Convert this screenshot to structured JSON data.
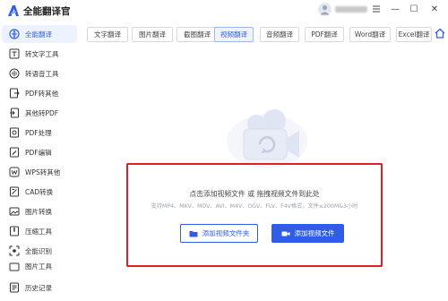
{
  "app": {
    "title": "全能翻译官"
  },
  "window": {
    "minimize": "—",
    "restore": "☐",
    "close": "✕"
  },
  "colors": {
    "accent": "#2f5de8",
    "highlight_border": "#e21d25",
    "active_bg": "#edf2ff"
  },
  "sidebar": {
    "items": [
      {
        "label": "全能翻译",
        "icon": "translate-icon",
        "active": true
      },
      {
        "label": "转文字工具",
        "icon": "text-convert-icon",
        "active": false
      },
      {
        "label": "转语音工具",
        "icon": "voice-icon",
        "active": false
      },
      {
        "label": "PDF转其他",
        "icon": "pdf-export-icon",
        "active": false
      },
      {
        "label": "其他转PDF",
        "icon": "pdf-import-icon",
        "active": false
      },
      {
        "label": "PDF处理",
        "icon": "pdf-process-icon",
        "active": false
      },
      {
        "label": "PDF编辑",
        "icon": "pdf-edit-icon",
        "active": false
      },
      {
        "label": "WPS转其他",
        "icon": "wps-icon",
        "active": false
      },
      {
        "label": "CAD转换",
        "icon": "cad-icon",
        "active": false
      },
      {
        "label": "图片转换",
        "icon": "image-convert-icon",
        "active": false
      },
      {
        "label": "压缩工具",
        "icon": "compress-icon",
        "active": false
      },
      {
        "label": "全能识别",
        "icon": "recognize-icon",
        "active": false
      },
      {
        "label": "图片工具",
        "icon": "image-tool-icon",
        "active": false
      },
      {
        "label": "历史记录",
        "icon": "history-icon",
        "active": false
      }
    ]
  },
  "tabs": [
    {
      "label": "文字翻译",
      "active": false
    },
    {
      "label": "图片翻译",
      "active": false
    },
    {
      "label": "截图翻译",
      "active": false
    },
    {
      "label": "视频翻译",
      "active": true
    },
    {
      "label": "音频翻译",
      "active": false
    },
    {
      "label": "PDF翻译",
      "active": false
    },
    {
      "label": "Word翻译",
      "active": false
    },
    {
      "label": "Excel翻译",
      "active": false
    }
  ],
  "dropzone": {
    "main_text": "点击添加视频文件 或 拖拽视频文件到此处",
    "sub_text": "支持MP4、MKV、MOV、AVI、M4V、OGV、FLV、F4V格式，文件≤200M&3小时",
    "add_folder_label": "添加视频文件夹",
    "add_file_label": "添加视频文件"
  }
}
